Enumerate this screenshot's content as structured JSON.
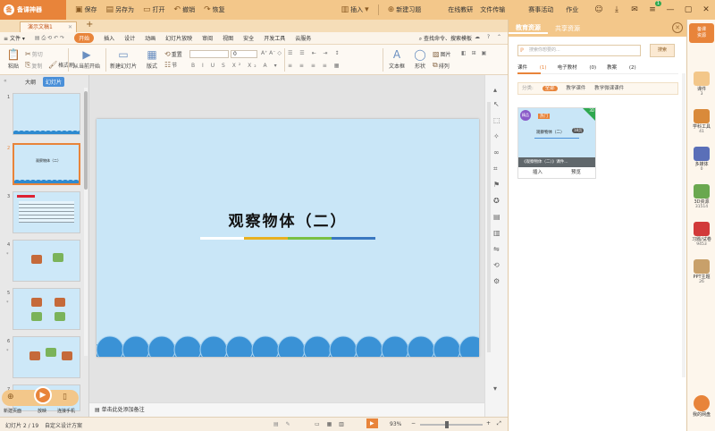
{
  "titlebar": {
    "brand": "备课神器",
    "buttons": [
      {
        "label": "保存",
        "icon": "save-icon"
      },
      {
        "label": "另存为",
        "icon": "save-as-icon"
      },
      {
        "label": "打开",
        "icon": "folder-icon"
      },
      {
        "label": "撤销",
        "icon": "undo-icon"
      },
      {
        "label": "恢复",
        "icon": "redo-icon"
      }
    ],
    "insert_label": "插入",
    "new_exercise_label": "新建习题",
    "links": [
      "在线教研",
      "文件传输",
      "赛事活动",
      "作业"
    ],
    "badge_count": "1"
  },
  "doctab": {
    "title": "演示文稿1",
    "new_tab": "+"
  },
  "menubar": {
    "file": "文件",
    "items": [
      "开始",
      "插入",
      "设计",
      "动画",
      "幻灯片放映",
      "审阅",
      "视图",
      "安全",
      "开发工具",
      "云服务"
    ],
    "active": "开始",
    "search": "查找命令、搜索模板"
  },
  "ribbon": {
    "paste": "粘贴",
    "cut": "剪切",
    "copy": "复制",
    "format_painter": "格式刷",
    "from_current": "从当前开始",
    "new_slide": "新建幻灯片",
    "layout": "版式",
    "section": "节",
    "reset": "重置",
    "font_size": "0",
    "textbox": "文本框",
    "shape": "形状",
    "picture": "图片",
    "arrange": "排列"
  },
  "leftpanel": {
    "tabs": [
      "大纲",
      "幻灯片"
    ],
    "active_tab": "幻灯片",
    "slides": [
      {
        "num": "1",
        "star": ""
      },
      {
        "num": "2",
        "star": "",
        "title": "观察物体（二）"
      },
      {
        "num": "3",
        "star": ""
      },
      {
        "num": "4",
        "star": "*"
      },
      {
        "num": "5",
        "star": "*"
      },
      {
        "num": "6",
        "star": "*"
      },
      {
        "num": "7",
        "star": ""
      }
    ],
    "floatbar": {
      "left": "新建页面",
      "mid": "放映",
      "right": "连接手机"
    }
  },
  "slide": {
    "title": "观察物体（二）",
    "line_colors": [
      "#ffffff",
      "#e8b020",
      "#7ac043",
      "#3a78c0"
    ]
  },
  "notes": {
    "placeholder": "单击此处添加备注"
  },
  "statusbar": {
    "slide_info": "幻灯片 2 / 19",
    "theme": "自定义设计方案",
    "zoom": "93%",
    "zoom_fraction": 0.4
  },
  "respanel": {
    "tabs": [
      "教育资源",
      "共享资源"
    ],
    "active_tab": "教育资源",
    "search_placeholder": "搜索你想要的...",
    "search_button": "搜索",
    "filters": [
      {
        "label": "课件",
        "count": "(1)"
      },
      {
        "label": "电子教材",
        "count": "(0)"
      },
      {
        "label": "教案",
        "count": "(2)"
      }
    ],
    "category_label": "分类:",
    "categories": [
      "全部",
      "教学课件",
      "教学微课课件"
    ],
    "active_category": "全部",
    "card": {
      "hot": "热门",
      "circle": "精品",
      "corner": "3D",
      "title": "观察物体（二）",
      "count": "18页",
      "caption": "《观察物体（二）》课件...",
      "insert": "插入",
      "preview": "预览"
    }
  },
  "iconbar": {
    "top": "备课\n资源",
    "items": [
      {
        "label": "课件",
        "count": "3",
        "color": "#f3c78a"
      },
      {
        "label": "学科工具",
        "count": "41",
        "color": "#d98a3a"
      },
      {
        "label": "多媒体",
        "count": "0",
        "color": "#5a6fb8"
      },
      {
        "label": "3D资源",
        "count": "31514",
        "color": "#6aa84f"
      },
      {
        "label": "习题/试卷",
        "count": "9453",
        "color": "#d23a3a"
      },
      {
        "label": "PPT主题",
        "count": "26",
        "color": "#c8a06a"
      }
    ],
    "bottom": "我的网盘"
  }
}
